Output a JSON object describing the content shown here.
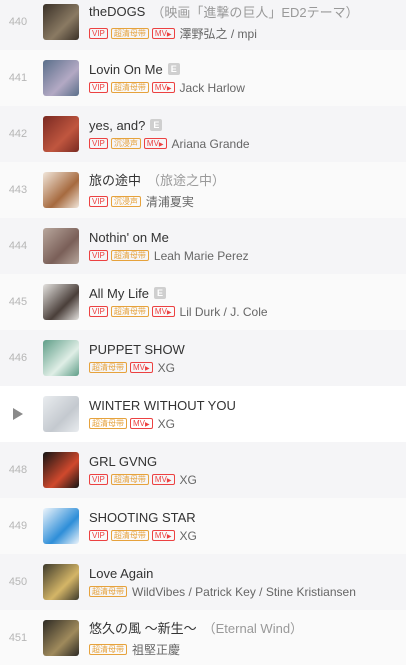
{
  "tracks": [
    {
      "index": "440",
      "title": "theDOGS",
      "subtitle": "（映画「進撃の巨人」ED2テーマ）",
      "explicit": false,
      "tags": [
        "VIP",
        "超清母带",
        "MV"
      ],
      "artist": "澤野弘之 / mpi",
      "cover_color": "#3a3128",
      "cover_accent": "#8a7a63"
    },
    {
      "index": "441",
      "title": "Lovin On Me",
      "subtitle": "",
      "explicit": true,
      "explicit_label": "E",
      "tags": [
        "VIP",
        "超清母带",
        "MV"
      ],
      "artist": "Jack Harlow",
      "cover_color": "#5a6f8a",
      "cover_accent": "#b3a9c4"
    },
    {
      "index": "442",
      "title": "yes, and?",
      "subtitle": "",
      "explicit": true,
      "explicit_label": "E",
      "tags": [
        "VIP",
        "沉浸声",
        "MV"
      ],
      "artist": "Ariana Grande",
      "cover_color": "#7a2a22",
      "cover_accent": "#c0563f"
    },
    {
      "index": "443",
      "title": "旅の途中",
      "subtitle": "（旅途之中）",
      "explicit": false,
      "tags": [
        "VIP",
        "沉浸声"
      ],
      "artist": "清浦夏実",
      "cover_color": "#f1e6da",
      "cover_accent": "#a66a3f"
    },
    {
      "index": "444",
      "title": "Nothin' on Me",
      "subtitle": "",
      "explicit": false,
      "tags": [
        "VIP",
        "超清母带"
      ],
      "artist": "Leah Marie Perez",
      "cover_color": "#b8a79d",
      "cover_accent": "#7a5f58"
    },
    {
      "index": "445",
      "title": "All My Life",
      "subtitle": "",
      "explicit": true,
      "explicit_label": "E",
      "tags": [
        "VIP",
        "超清母带",
        "MV"
      ],
      "artist": "Lil Durk / J. Cole",
      "cover_color": "#e4e2df",
      "cover_accent": "#4a3f3a"
    },
    {
      "index": "446",
      "title": "PUPPET SHOW",
      "subtitle": "",
      "explicit": false,
      "tags": [
        "超清母带",
        "MV"
      ],
      "artist": "XG",
      "cover_color": "#5f9e88",
      "cover_accent": "#dfeee6"
    },
    {
      "index": "447",
      "title": "WINTER WITHOUT YOU",
      "subtitle": "",
      "explicit": false,
      "tags": [
        "超清母带",
        "MV"
      ],
      "artist": "XG",
      "cover_color": "#e9ecef",
      "cover_accent": "#c4c9cf",
      "playing": true
    },
    {
      "index": "448",
      "title": "GRL GVNG",
      "subtitle": "",
      "explicit": false,
      "tags": [
        "VIP",
        "超清母带",
        "MV"
      ],
      "artist": "XG",
      "cover_color": "#141414",
      "cover_accent": "#d0492d"
    },
    {
      "index": "449",
      "title": "SHOOTING STAR",
      "subtitle": "",
      "explicit": false,
      "tags": [
        "VIP",
        "超清母带",
        "MV"
      ],
      "artist": "XG",
      "cover_color": "#eef5fb",
      "cover_accent": "#2e8ed8"
    },
    {
      "index": "450",
      "title": "Love Again",
      "subtitle": "",
      "explicit": false,
      "tags": [
        "超清母带"
      ],
      "artist": "WildVibes / Patrick Key / Stine Kristiansen",
      "cover_color": "#3d3a2c",
      "cover_accent": "#d4b567"
    },
    {
      "index": "451",
      "title": "悠久の風 ～新生～",
      "subtitle": "（Eternal Wind）",
      "explicit": false,
      "tags": [
        "超清母带"
      ],
      "artist": "祖堅正慶",
      "cover_color": "#2d2a24",
      "cover_accent": "#9f8a5c"
    }
  ],
  "colors": {
    "vip": "#ec4141",
    "hq": "#e6a23c",
    "index": "#b6b6b6",
    "play_icon": "#8a8a8a"
  },
  "icons": {
    "play": "play-icon",
    "explicit": "explicit-icon"
  }
}
